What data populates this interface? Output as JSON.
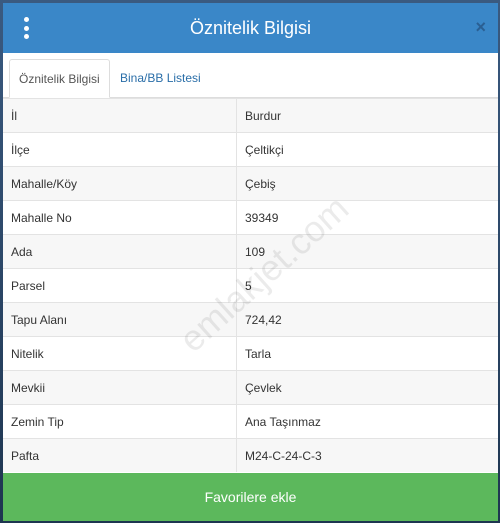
{
  "dialog": {
    "title": "Öznitelik Bilgisi",
    "close_label": "×"
  },
  "tabs": [
    {
      "label": "Öznitelik Bilgisi",
      "active": true
    },
    {
      "label": "Bina/BB Listesi",
      "active": false
    }
  ],
  "rows": [
    {
      "key": "İl",
      "value": "Burdur"
    },
    {
      "key": "İlçe",
      "value": "Çeltikçi"
    },
    {
      "key": "Mahalle/Köy",
      "value": "Çebiş"
    },
    {
      "key": "Mahalle No",
      "value": "39349"
    },
    {
      "key": "Ada",
      "value": "109"
    },
    {
      "key": "Parsel",
      "value": "5"
    },
    {
      "key": "Tapu Alanı",
      "value": "724,42"
    },
    {
      "key": "Nitelik",
      "value": "Tarla"
    },
    {
      "key": "Mevkii",
      "value": "Çevlek"
    },
    {
      "key": "Zemin Tip",
      "value": "Ana Taşınmaz"
    },
    {
      "key": "Pafta",
      "value": "M24-C-24-C-3"
    }
  ],
  "watermark": "emlakjet.com",
  "favorite_button": "Favorilere ekle",
  "colors": {
    "header": "#3a87c8",
    "button": "#5cb85c",
    "link": "#2a6ea8"
  }
}
